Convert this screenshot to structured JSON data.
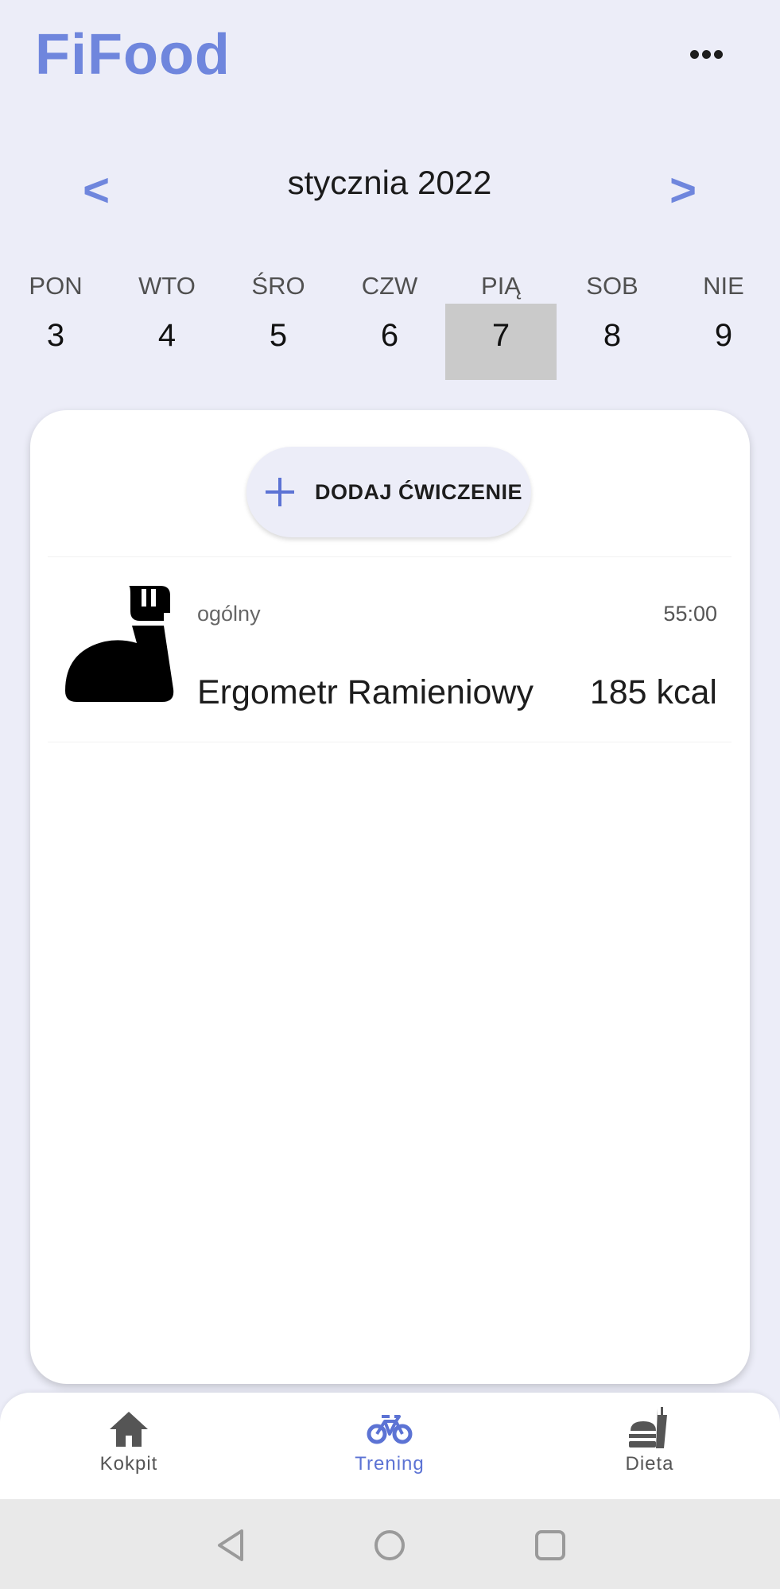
{
  "header": {
    "app_title": "FiFood",
    "menu_icon": "more-horizontal-icon"
  },
  "date_nav": {
    "prev_label": "<",
    "next_label": ">",
    "month_label": "stycznia 2022"
  },
  "week": {
    "days": [
      {
        "name": "PON",
        "num": "3"
      },
      {
        "name": "WTO",
        "num": "4"
      },
      {
        "name": "ŚRO",
        "num": "5"
      },
      {
        "name": "CZW",
        "num": "6"
      },
      {
        "name": "PIĄ",
        "num": "7",
        "selected": true
      },
      {
        "name": "SOB",
        "num": "8"
      },
      {
        "name": "NIE",
        "num": "9"
      }
    ]
  },
  "main": {
    "add_button_label": "DODAJ ĆWICZENIE",
    "exercises": [
      {
        "category": "ogólny",
        "duration": "55:00",
        "name": "Ergometr Ramieniowy",
        "kcal": "185 kcal",
        "icon": "flexed-arm-icon"
      }
    ]
  },
  "bottom_nav": {
    "tabs": [
      {
        "label": "Kokpit",
        "icon": "home-icon"
      },
      {
        "label": "Trening",
        "icon": "bicycle-icon",
        "active": true
      },
      {
        "label": "Dieta",
        "icon": "fastfood-icon"
      }
    ]
  },
  "colors": {
    "accent": "#6f86dd",
    "background": "#ecedf8",
    "selected_day": "#cacaca"
  }
}
